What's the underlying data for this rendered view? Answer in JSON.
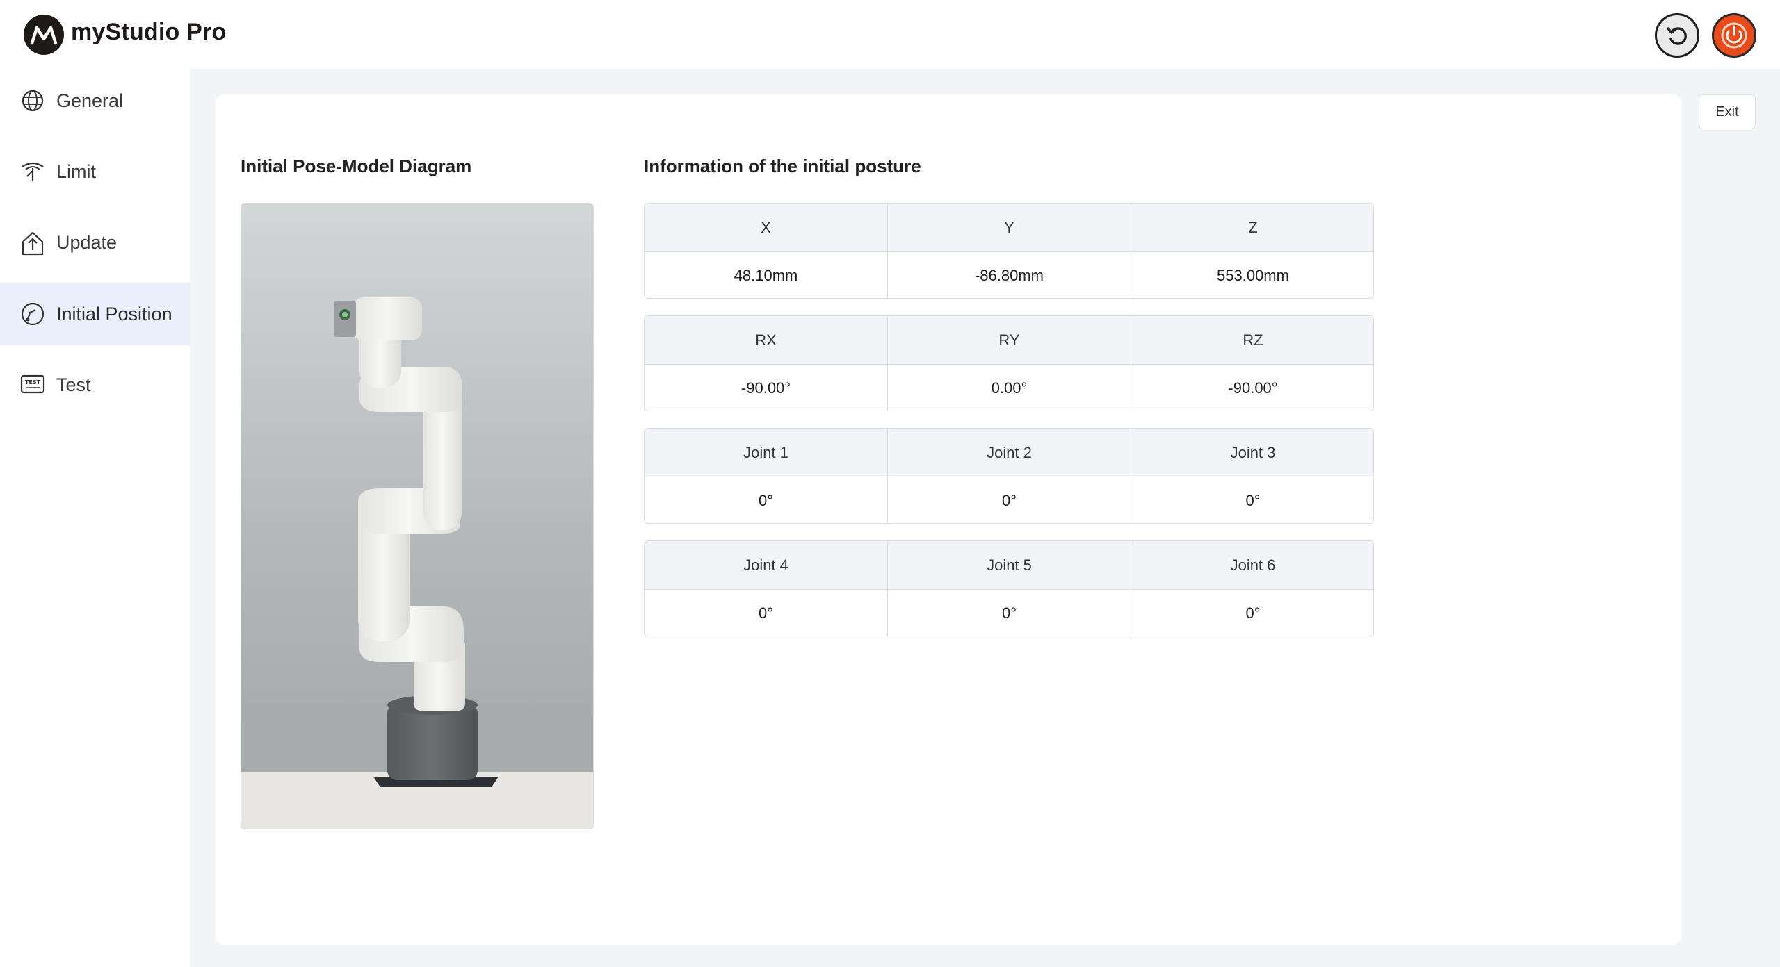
{
  "app": {
    "title": "myStudio Pro"
  },
  "sidebar": {
    "items": [
      {
        "label": "General",
        "icon": "globe-icon"
      },
      {
        "label": "Limit",
        "icon": "limit-icon"
      },
      {
        "label": "Update",
        "icon": "update-icon"
      },
      {
        "label": "Initial Position",
        "icon": "initial-position-icon",
        "active": true
      },
      {
        "label": "Test",
        "icon": "test-icon"
      }
    ]
  },
  "header": {
    "reset_icon": "reset-icon",
    "power_icon": "power-icon"
  },
  "main": {
    "exit_label": "Exit",
    "diagram_title": "Initial Pose-Model Diagram",
    "info_title": "Information of the initial posture",
    "tables": [
      {
        "headers": [
          "X",
          "Y",
          "Z"
        ],
        "values": [
          "48.10mm",
          "-86.80mm",
          "553.00mm"
        ]
      },
      {
        "headers": [
          "RX",
          "RY",
          "RZ"
        ],
        "values": [
          "-90.00°",
          "0.00°",
          "-90.00°"
        ]
      },
      {
        "headers": [
          "Joint 1",
          "Joint 2",
          "Joint 3"
        ],
        "values": [
          "0°",
          "0°",
          "0°"
        ]
      },
      {
        "headers": [
          "Joint 4",
          "Joint 5",
          "Joint 6"
        ],
        "values": [
          "0°",
          "0°",
          "0°"
        ]
      }
    ]
  },
  "colors": {
    "accent_active_bg": "#eaf0fb",
    "main_bg": "#f3f4f6",
    "power_button": "#e84a1a"
  }
}
